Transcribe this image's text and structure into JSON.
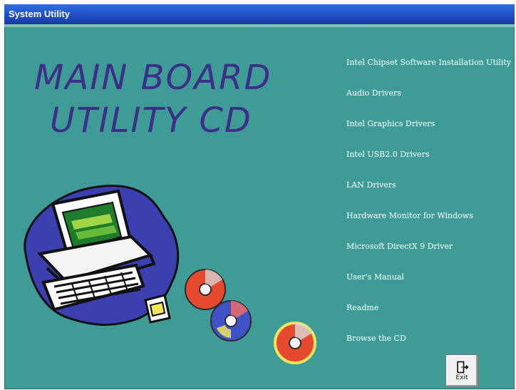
{
  "window": {
    "title": "System Utility"
  },
  "hero": {
    "line1": "MAIN BOARD",
    "line2": "UTILITY  CD"
  },
  "menu": {
    "items": [
      {
        "label": "Intel Chipset Software Installation Utility"
      },
      {
        "label": "Audio Drivers"
      },
      {
        "label": "Intel Graphics Drivers"
      },
      {
        "label": "Intel USB2.0 Drivers"
      },
      {
        "label": "LAN Drivers"
      },
      {
        "label": "Hardware Monitor for Windows"
      },
      {
        "label": "Microsoft DirectX 9 Driver"
      },
      {
        "label": "User's Manual"
      },
      {
        "label": "Readme"
      },
      {
        "label": "Browse the CD"
      }
    ]
  },
  "exit_button": {
    "label": "Exit",
    "icon": "exit-door-icon"
  },
  "colors": {
    "background": "#3e9b96",
    "titlebar": "#1f4fc5",
    "hero_text": "#3c2f86",
    "menu_text": "#d9f1ef"
  },
  "illustration": {
    "icons": [
      "computer-icon",
      "floppy-disk-icon",
      "cd-disc-icon"
    ]
  }
}
